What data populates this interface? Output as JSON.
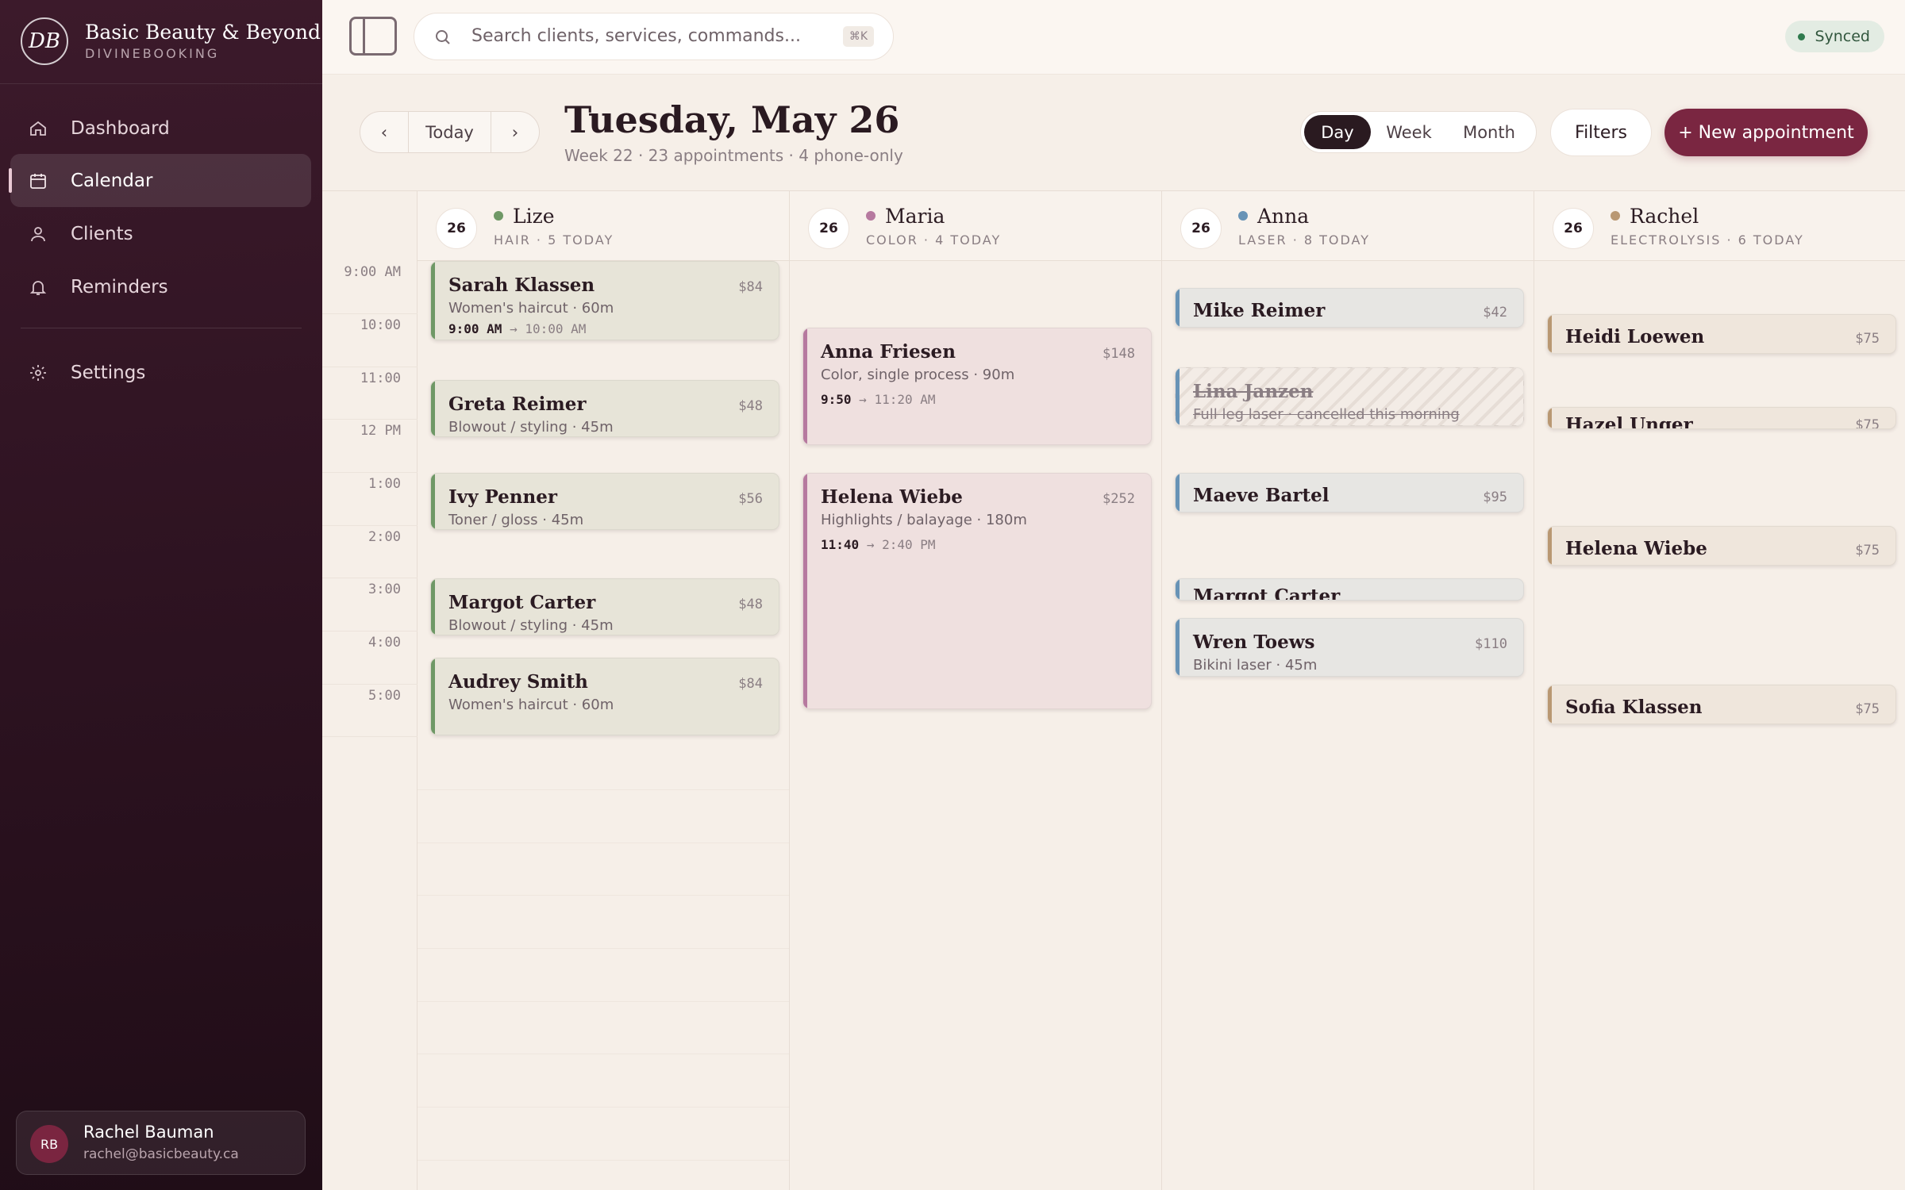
{
  "sidebar": {
    "brand": {
      "logo": "DB",
      "name": "Basic Beauty & Beyond",
      "sub": "DIVINEBOOKING"
    },
    "nav": [
      {
        "label": "Dashboard",
        "icon": "home-icon"
      },
      {
        "label": "Calendar",
        "icon": "calendar-icon",
        "active": true
      },
      {
        "label": "Clients",
        "icon": "user-icon"
      },
      {
        "label": "Reminders",
        "icon": "bell-icon"
      }
    ],
    "settings": {
      "label": "Settings",
      "icon": "gear-icon"
    },
    "user": {
      "initials": "RB",
      "name": "Rachel Bauman",
      "email": "rachel@basicbeauty.ca"
    }
  },
  "topbar": {
    "search_placeholder": "Search clients, services, commands...",
    "shortcut": "⌘K",
    "status": "Synced"
  },
  "header": {
    "prev": "‹",
    "today": "Today",
    "next": "›",
    "title": "Tuesday, May 26",
    "subtitle": "Week 22 · 23 appointments · 4 phone-only",
    "views": [
      "Day",
      "Week",
      "Month"
    ],
    "active_view": "Day",
    "filters": "Filters",
    "new_appointment": "+ New appointment"
  },
  "times": [
    "9:00 AM",
    "10:00",
    "11:00",
    "12 PM",
    "1:00",
    "2:00",
    "3:00",
    "4:00",
    "5:00"
  ],
  "columns": [
    {
      "day": "26",
      "name": "Lize",
      "meta": "HAIR · 5 TODAY",
      "color": "#6f9866",
      "appointments": [
        {
          "name": "Sarah Klassen",
          "price": "$84",
          "service": "Women's haircut · 60m",
          "start": "9:00 AM",
          "end": "10:00 AM"
        },
        {
          "name": "Greta Reimer",
          "price": "$48",
          "service": "Blowout / styling · 45m"
        },
        {
          "name": "Ivy Penner",
          "price": "$56",
          "service": "Toner / gloss · 45m"
        },
        {
          "name": "Margot Carter",
          "price": "$48",
          "service": "Blowout / styling · 45m"
        },
        {
          "name": "Audrey Smith",
          "price": "$84",
          "service": "Women's haircut · 60m"
        }
      ]
    },
    {
      "day": "26",
      "name": "Maria",
      "meta": "COLOR · 4 TODAY",
      "color": "#b6799f",
      "appointments": [
        {
          "name": "Anna Friesen",
          "price": "$148",
          "service": "Color, single process · 90m",
          "start": "9:50",
          "end": "11:20 AM"
        },
        {
          "name": "Helena Wiebe",
          "price": "$252",
          "service": "Highlights / balayage · 180m",
          "start": "11:40",
          "end": "2:40 PM"
        }
      ]
    },
    {
      "day": "26",
      "name": "Anna",
      "meta": "LASER · 8 TODAY",
      "color": "#6893b6",
      "appointments": [
        {
          "name": "Mike Reimer",
          "price": "$42"
        },
        {
          "name": "Lina Janzen",
          "service": "Full leg laser · cancelled this morning",
          "cancelled": true
        },
        {
          "name": "Maeve Bartel",
          "price": "$95"
        },
        {
          "name": "Margot Carter",
          "price": ""
        },
        {
          "name": "Wren Toews",
          "price": "$110",
          "service": "Bikini laser · 45m"
        }
      ]
    },
    {
      "day": "26",
      "name": "Rachel",
      "meta": "ELECTROLYSIS · 6 TODAY",
      "color": "#b99873",
      "appointments": [
        {
          "name": "Heidi Loewen",
          "price": "$75"
        },
        {
          "name": "Hazel Unger",
          "price": "$75"
        },
        {
          "name": "Helena Wiebe",
          "price": "$75"
        },
        {
          "name": "Sofia Klassen",
          "price": "$75"
        }
      ]
    }
  ]
}
